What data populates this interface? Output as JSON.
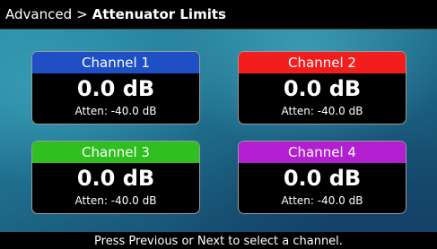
{
  "header": {
    "breadcrumb_parent": "Advanced",
    "breadcrumb_separator": ">",
    "title": "Attenuator Limits"
  },
  "channels": [
    {
      "name": "Channel 1",
      "value": "0.0 dB",
      "atten": "Atten: -40.0 dB",
      "color": "#1f4fc4"
    },
    {
      "name": "Channel 2",
      "value": "0.0 dB",
      "atten": "Atten: -40.0 dB",
      "color": "#f21d1d"
    },
    {
      "name": "Channel 3",
      "value": "0.0 dB",
      "atten": "Atten: -40.0 dB",
      "color": "#2fbf1f"
    },
    {
      "name": "Channel 4",
      "value": "0.0 dB",
      "atten": "Atten: -40.0 dB",
      "color": "#b21fd0"
    }
  ],
  "footer": {
    "hint": "Press Previous or Next to select a channel."
  }
}
